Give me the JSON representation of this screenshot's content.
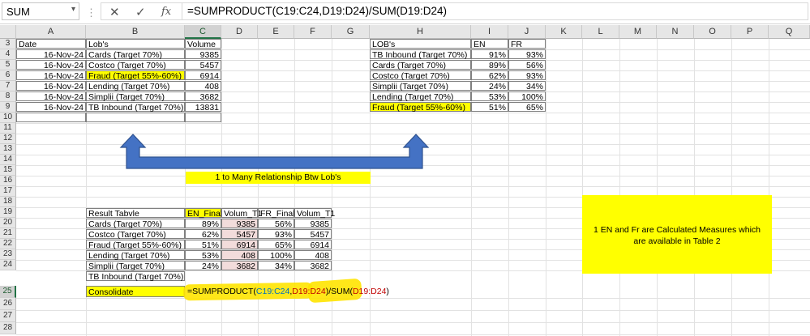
{
  "formula_bar": {
    "name_box": "SUM",
    "name_box_arrow": "▾",
    "separator": "⋮",
    "cancel_icon": "✕",
    "enter_icon": "✓",
    "fx_icon": "fx",
    "formula": "=SUMPRODUCT(C19:C24,D19:D24)/SUM(D19:D24)"
  },
  "columns": [
    "A",
    "B",
    "C",
    "D",
    "E",
    "F",
    "G",
    "H",
    "I",
    "J",
    "K",
    "L",
    "M",
    "N",
    "O",
    "P",
    "Q"
  ],
  "rows": [
    "3",
    "4",
    "5",
    "6",
    "7",
    "8",
    "9",
    "10",
    "11",
    "12",
    "13",
    "14",
    "15",
    "16",
    "17",
    "18",
    "19",
    "20",
    "21",
    "22",
    "23",
    "24",
    "25",
    "26",
    "27",
    "28"
  ],
  "table1": {
    "headers": [
      "Date",
      "Lob's",
      "Volume"
    ],
    "rows": [
      {
        "date": "16-Nov-24",
        "lob": "Cards (Target 70%)",
        "volume": "9385"
      },
      {
        "date": "16-Nov-24",
        "lob": "Costco (Target 70%)",
        "volume": "5457"
      },
      {
        "date": "16-Nov-24",
        "lob": "Fraud (Target 55%-60%)",
        "volume": "6914"
      },
      {
        "date": "16-Nov-24",
        "lob": "Lending (Target 70%)",
        "volume": "408"
      },
      {
        "date": "16-Nov-24",
        "lob": "Simplii (Target 70%)",
        "volume": "3682"
      },
      {
        "date": "16-Nov-24",
        "lob": "TB Inbound  (Target 70%)",
        "volume": "13831"
      }
    ]
  },
  "table2": {
    "headers": [
      "LOB's",
      "EN",
      "FR"
    ],
    "rows": [
      {
        "lob": "TB Inbound  (Target 70%)",
        "en": "91%",
        "fr": "93%"
      },
      {
        "lob": "Cards (Target 70%)",
        "en": "89%",
        "fr": "56%"
      },
      {
        "lob": "Costco (Target 70%)",
        "en": "62%",
        "fr": "93%"
      },
      {
        "lob": "Simplii (Target 70%)",
        "en": "24%",
        "fr": "34%"
      },
      {
        "lob": "Lending (Target 70%)",
        "en": "53%",
        "fr": "100%"
      },
      {
        "lob": "Fraud (Target 55%-60%)",
        "en": "51%",
        "fr": "65%"
      }
    ]
  },
  "relationship_label": "1 to Many Relationship Btw Lob's",
  "note": "1 EN and Fr  are Calculated Measures which are available in Table 2",
  "result": {
    "headers": [
      "Result Tabvle",
      "EN_Final",
      "Volum_T1",
      "FR_Final",
      "Volum_T1"
    ],
    "rows": [
      {
        "lob": "Cards (Target 70%)",
        "en": "89%",
        "vol1": "9385",
        "fr": "56%",
        "vol2": "9385"
      },
      {
        "lob": "Costco (Target 70%)",
        "en": "62%",
        "vol1": "5457",
        "fr": "93%",
        "vol2": "5457"
      },
      {
        "lob": "Fraud (Target 55%-60%)",
        "en": "51%",
        "vol1": "6914",
        "fr": "65%",
        "vol2": "6914"
      },
      {
        "lob": "Lending (Target 70%)",
        "en": "53%",
        "vol1": "408",
        "fr": "100%",
        "vol2": "408"
      },
      {
        "lob": "Simplii (Target 70%)",
        "en": "24%",
        "vol1": "3682",
        "fr": "34%",
        "vol2": "3682"
      },
      {
        "lob": "TB Inbound  (Target 70%)",
        "en": "",
        "vol1": "",
        "fr": "",
        "vol2": ""
      }
    ],
    "consolidate_label": "Consolidate",
    "formula_parts": [
      "=SUMPRODUCT(",
      "C19:C24",
      ",",
      "D19:D24",
      ")/SUM(",
      "D19:D24",
      ")"
    ]
  },
  "colors": {
    "highlight": "#ffff00",
    "pink_fill": "#f2dcdb",
    "arrow_fill": "#4472c4",
    "arrow_stroke": "#2f528f",
    "ref_c": "#0070c0",
    "ref_d": "#c00000",
    "selected_header": "#217346"
  }
}
